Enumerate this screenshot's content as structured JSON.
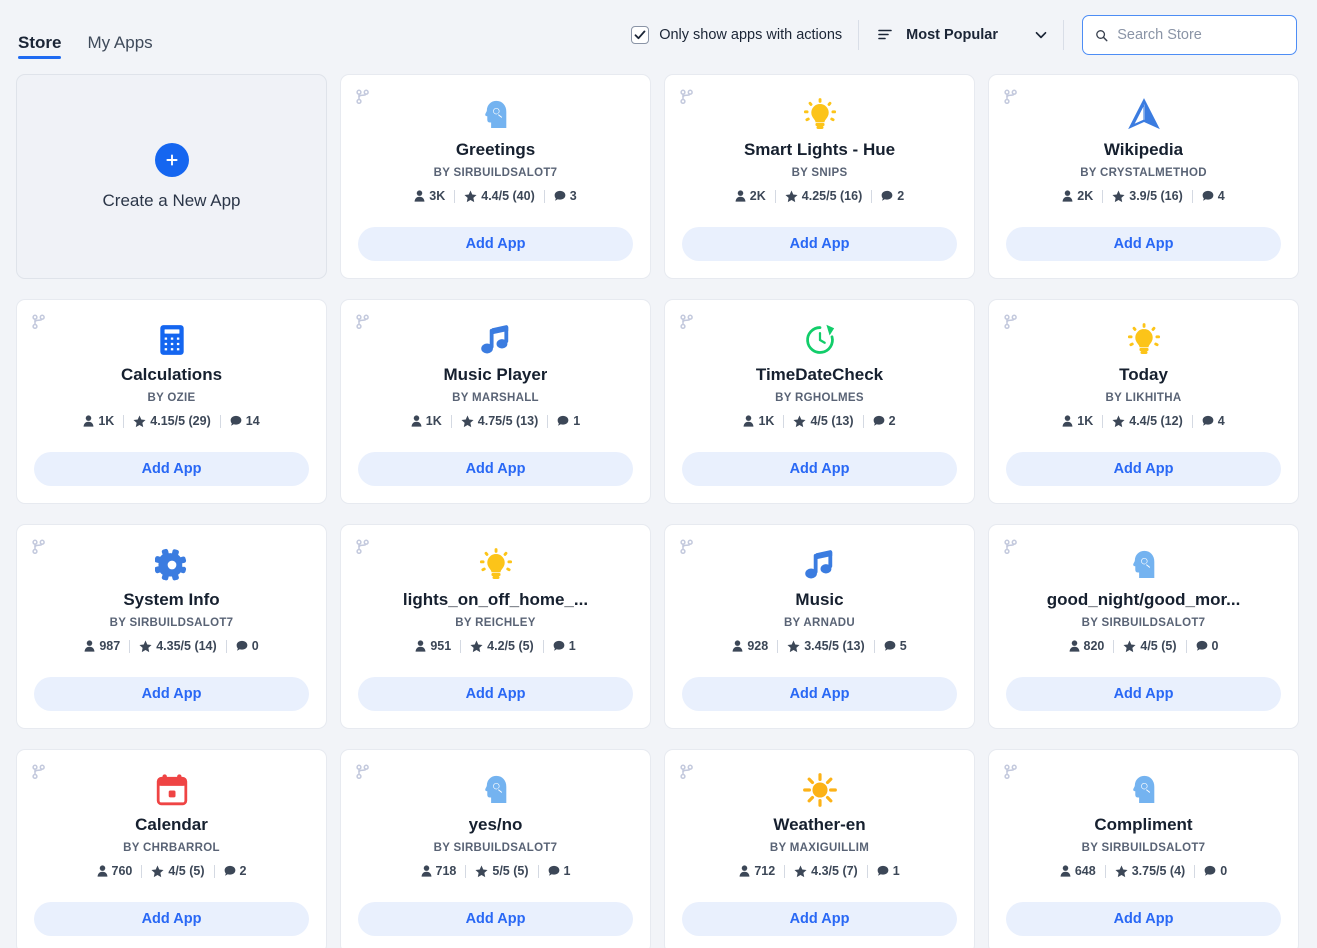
{
  "header": {
    "tabs": [
      {
        "label": "Store",
        "active": true
      },
      {
        "label": "My Apps",
        "active": false
      }
    ],
    "filter_checkbox": {
      "label": "Only show apps with actions",
      "checked": true
    },
    "sort": {
      "icon": "sort-icon",
      "label": "Most Popular",
      "chevron": "chevron-down-icon"
    },
    "search": {
      "icon": "search-icon",
      "placeholder": "Search Store",
      "value": ""
    }
  },
  "colors": {
    "page_bg": "#f2f4f8",
    "card_bg": "#ffffff",
    "accent_blue": "#1f6bf2",
    "add_btn_bg": "#e9f0fd",
    "add_btn_text": "#2968f5",
    "icon_blue": "#1f6bf2",
    "icon_light_blue": "#74b3f0",
    "icon_yellow": "#fcc419",
    "icon_green": "#12cd6a",
    "icon_red": "#ef4444",
    "fork_icon": "#c3c9dd"
  },
  "create_card": {
    "icon": "plus-icon",
    "label": "Create a New App"
  },
  "cards": [
    {
      "title": "Greetings",
      "author": "BY SIRBUILDSALOT7",
      "users": "3K",
      "rating": "4.4/5 (40)",
      "comments": "3",
      "add_label": "Add App",
      "icon": "head-assistant-icon",
      "icon_color": "#74b3f0"
    },
    {
      "title": "Smart Lights - Hue",
      "author": "BY SNIPS",
      "users": "2K",
      "rating": "4.25/5 (16)",
      "comments": "2",
      "add_label": "Add App",
      "icon": "lightbulb-icon",
      "icon_color": "#fcc419"
    },
    {
      "title": "Wikipedia",
      "author": "BY CRYSTALMETHOD",
      "users": "2K",
      "rating": "3.9/5 (16)",
      "comments": "4",
      "add_label": "Add App",
      "icon": "navigation-triangle-icon",
      "icon_color": "#3b7ce0"
    },
    {
      "title": "Calculations",
      "author": "BY OZIE",
      "users": "1K",
      "rating": "4.15/5 (29)",
      "comments": "14",
      "add_label": "Add App",
      "icon": "calculator-icon",
      "icon_color": "#1566f0"
    },
    {
      "title": "Music Player",
      "author": "BY MARSHALL",
      "users": "1K",
      "rating": "4.75/5 (13)",
      "comments": "1",
      "add_label": "Add App",
      "icon": "music-note-icon",
      "icon_color": "#3b7ce0"
    },
    {
      "title": "TimeDateCheck",
      "author": "BY RGHOLMES",
      "users": "1K",
      "rating": "4/5 (13)",
      "comments": "2",
      "add_label": "Add App",
      "icon": "clock-history-icon",
      "icon_color": "#12cd6a"
    },
    {
      "title": "Today",
      "author": "BY LIKHITHA",
      "users": "1K",
      "rating": "4.4/5 (12)",
      "comments": "4",
      "add_label": "Add App",
      "icon": "lightbulb-icon",
      "icon_color": "#fcc419"
    },
    {
      "title": "System Info",
      "author": "BY SIRBUILDSALOT7",
      "users": "987",
      "rating": "4.35/5 (14)",
      "comments": "0",
      "add_label": "Add App",
      "icon": "gear-icon",
      "icon_color": "#3b7ce0"
    },
    {
      "title": "lights_on_off_home_...",
      "author": "BY REICHLEY",
      "users": "951",
      "rating": "4.2/5 (5)",
      "comments": "1",
      "add_label": "Add App",
      "icon": "lightbulb-icon",
      "icon_color": "#fcc419"
    },
    {
      "title": "Music",
      "author": "BY ARNADU",
      "users": "928",
      "rating": "3.45/5 (13)",
      "comments": "5",
      "add_label": "Add App",
      "icon": "music-note-icon",
      "icon_color": "#3b7ce0"
    },
    {
      "title": "good_night/good_mor...",
      "author": "BY SIRBUILDSALOT7",
      "users": "820",
      "rating": "4/5 (5)",
      "comments": "0",
      "add_label": "Add App",
      "icon": "head-assistant-icon",
      "icon_color": "#74b3f0"
    },
    {
      "title": "Calendar",
      "author": "BY CHRBARROL",
      "users": "760",
      "rating": "4/5 (5)",
      "comments": "2",
      "add_label": "Add App",
      "icon": "calendar-icon",
      "icon_color": "#ef4444"
    },
    {
      "title": "yes/no",
      "author": "BY SIRBUILDSALOT7",
      "users": "718",
      "rating": "5/5 (5)",
      "comments": "1",
      "add_label": "Add App",
      "icon": "head-assistant-icon",
      "icon_color": "#74b3f0"
    },
    {
      "title": "Weather-en",
      "author": "BY MAXIGUILLIM",
      "users": "712",
      "rating": "4.3/5 (7)",
      "comments": "1",
      "add_label": "Add App",
      "icon": "sun-icon",
      "icon_color": "#fcb217"
    },
    {
      "title": "Compliment",
      "author": "BY SIRBUILDSALOT7",
      "users": "648",
      "rating": "3.75/5 (4)",
      "comments": "0",
      "add_label": "Add App",
      "icon": "head-assistant-icon",
      "icon_color": "#74b3f0"
    }
  ]
}
